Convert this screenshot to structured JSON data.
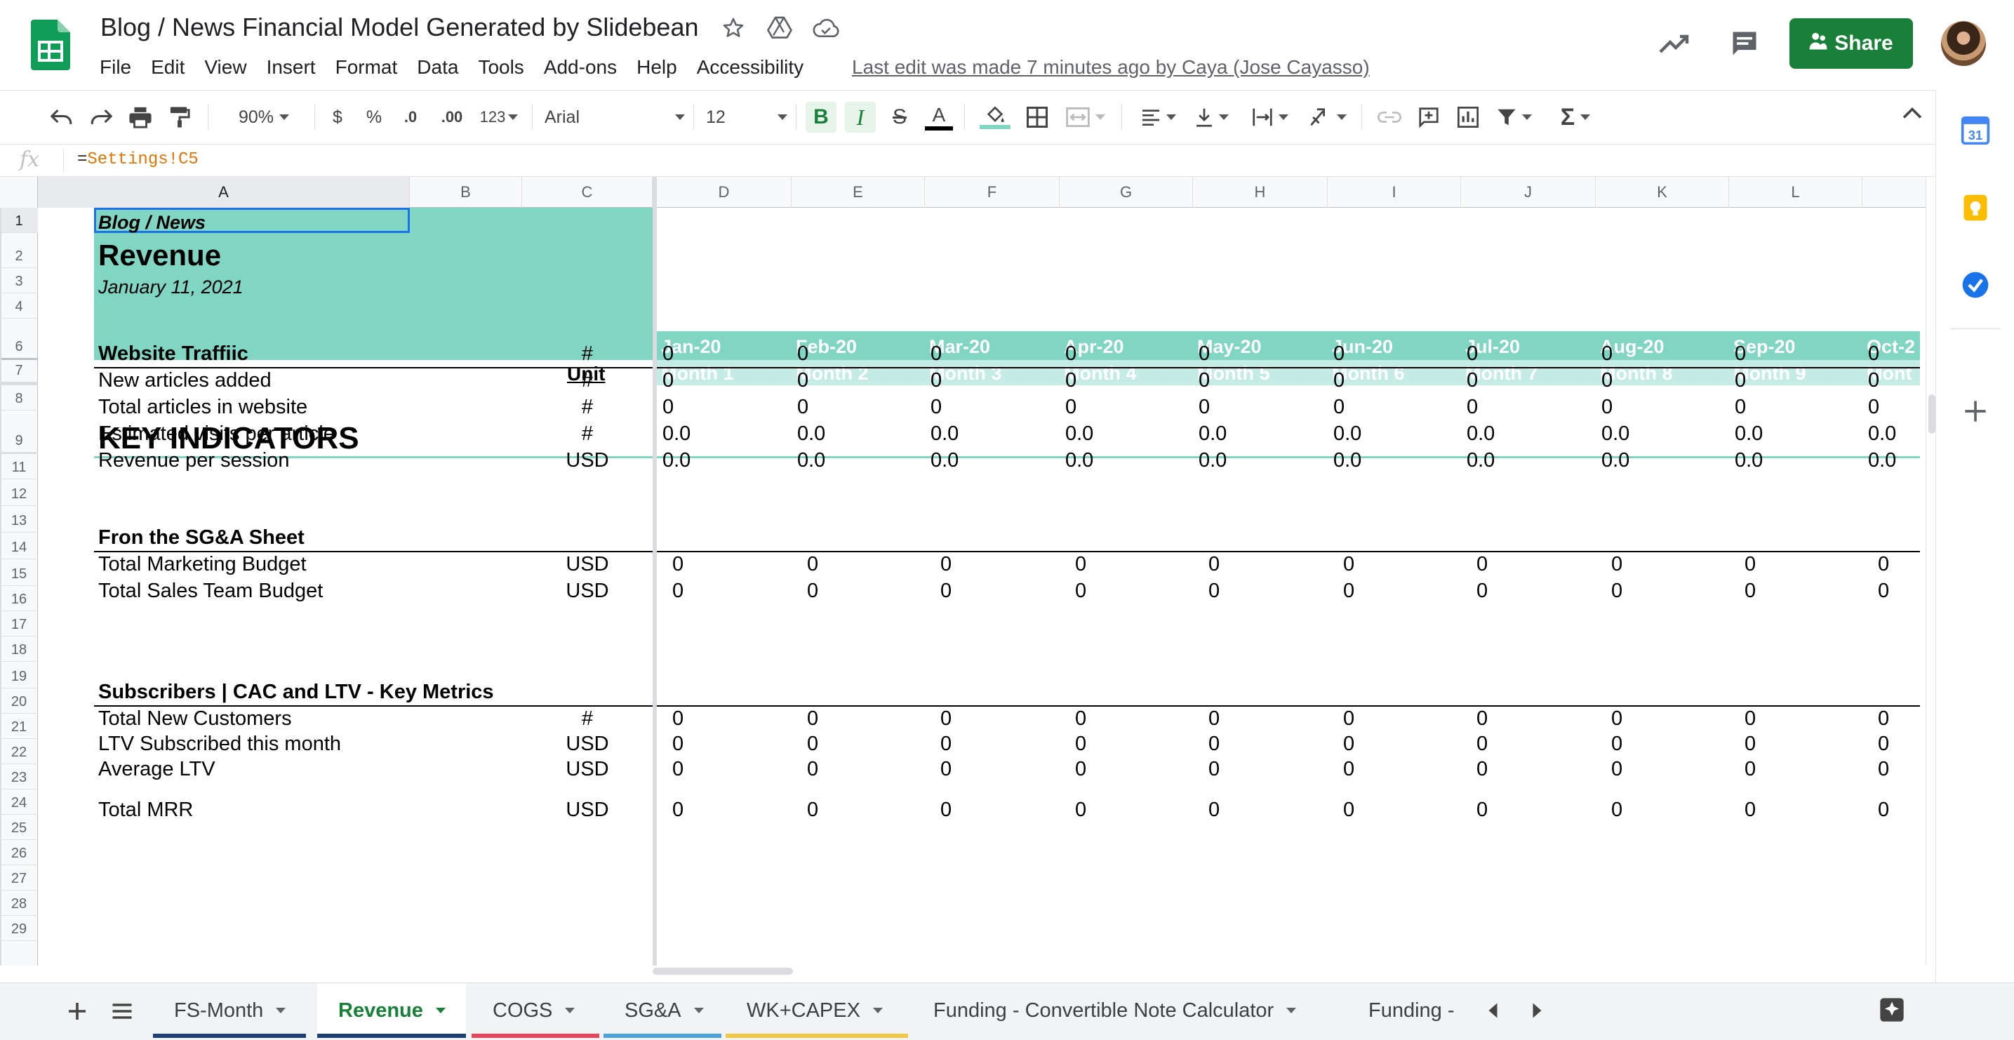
{
  "app": {
    "title": "Blog / News Financial Model Generated by Slidebean",
    "menu": [
      "File",
      "Edit",
      "View",
      "Insert",
      "Format",
      "Data",
      "Tools",
      "Add-ons",
      "Help",
      "Accessibility"
    ],
    "last_edit": "Last edit was made 7 minutes ago by Caya (Jose Cayasso)",
    "share_label": "Share"
  },
  "toolbar": {
    "zoom": "90%",
    "currency": "$",
    "percent": "%",
    "decrease_decimal": ".0",
    "increase_decimal": ".00",
    "more_formats": "123",
    "font": "Arial",
    "font_size": "12",
    "bold": "B",
    "italic": "I",
    "strike": "S",
    "text_color": "A"
  },
  "formula_bar": {
    "fx": "fx",
    "prefix": "=",
    "reference": "Settings!C5"
  },
  "columns": [
    "A",
    "B",
    "C",
    "D",
    "E",
    "F",
    "G",
    "H",
    "I",
    "J",
    "K",
    "L"
  ],
  "rows": [
    "1",
    "2",
    "3",
    "4",
    "6",
    "7",
    "8",
    "9",
    "11",
    "12",
    "13",
    "14",
    "15",
    "16",
    "17",
    "18",
    "19",
    "20",
    "21",
    "22",
    "23",
    "24",
    "25",
    "26",
    "27",
    "28",
    "29"
  ],
  "sheet": {
    "blog_news": "Blog / News",
    "revenue": "Revenue",
    "date": "January 11, 2021",
    "unit_header": "Unit",
    "key_indicators": "KEY INDICATORS",
    "months": [
      "Jan-20",
      "Feb-20",
      "Mar-20",
      "Apr-20",
      "May-20",
      "Jun-20",
      "Jul-20",
      "Aug-20",
      "Sep-20",
      "Oct-2"
    ],
    "month_nums": [
      "Month 1",
      "Month 2",
      "Month 3",
      "Month 4",
      "Month 5",
      "Month 6",
      "Month 7",
      "Month 8",
      "Month 9",
      "Mont"
    ],
    "rows": [
      {
        "label": "Website Traffiic",
        "unit": "#",
        "values": [
          "0",
          "0",
          "0",
          "0",
          "0",
          "0",
          "0",
          "0",
          "0",
          "0"
        ],
        "bold": true
      },
      {
        "label": "New articles added",
        "unit": "#",
        "values": [
          "0",
          "0",
          "0",
          "0",
          "0",
          "0",
          "0",
          "0",
          "0",
          "0"
        ]
      },
      {
        "label": "Total articles in website",
        "unit": "#",
        "values": [
          "0",
          "0",
          "0",
          "0",
          "0",
          "0",
          "0",
          "0",
          "0",
          "0"
        ]
      },
      {
        "label": "Estimated visits per article",
        "unit": "#",
        "values": [
          "0.0",
          "0.0",
          "0.0",
          "0.0",
          "0.0",
          "0.0",
          "0.0",
          "0.0",
          "0.0",
          "0.0"
        ]
      },
      {
        "label": "Revenue per session",
        "unit": "USD",
        "values": [
          "0.0",
          "0.0",
          "0.0",
          "0.0",
          "0.0",
          "0.0",
          "0.0",
          "0.0",
          "0.0",
          "0.0"
        ]
      },
      {
        "label": "Fron the SG&A Sheet",
        "bold": true
      },
      {
        "label": "Total Marketing Budget",
        "unit": "USD",
        "values": [
          "0",
          "0",
          "0",
          "0",
          "0",
          "0",
          "0",
          "0",
          "0",
          "0"
        ]
      },
      {
        "label": "Total Sales Team Budget",
        "unit": "USD",
        "values": [
          "0",
          "0",
          "0",
          "0",
          "0",
          "0",
          "0",
          "0",
          "0",
          "0"
        ]
      },
      {
        "label": "Subscribers | CAC and LTV - Key Metrics",
        "bold": true
      },
      {
        "label": "Total New Customers",
        "unit": "#",
        "values": [
          "0",
          "0",
          "0",
          "0",
          "0",
          "0",
          "0",
          "0",
          "0",
          "0"
        ]
      },
      {
        "label": "LTV Subscribed this month",
        "unit": "USD",
        "values": [
          "0",
          "0",
          "0",
          "0",
          "0",
          "0",
          "0",
          "0",
          "0",
          "0"
        ]
      },
      {
        "label": "Average LTV",
        "unit": "USD",
        "values": [
          "0",
          "0",
          "0",
          "0",
          "0",
          "0",
          "0",
          "0",
          "0",
          "0"
        ]
      },
      {
        "label": "Total MRR",
        "unit": "USD",
        "values": [
          "0",
          "0",
          "0",
          "0",
          "0",
          "0",
          "0",
          "0",
          "0",
          "0"
        ]
      }
    ]
  },
  "tabs": [
    {
      "label": "FS-Month",
      "color": "#1c3f7a",
      "active": false
    },
    {
      "label": "Revenue",
      "color": "#1c3f7a",
      "active": true
    },
    {
      "label": "COGS",
      "color": "#e8445a",
      "active": false
    },
    {
      "label": "SG&A",
      "color": "#4aa3df",
      "active": false
    },
    {
      "label": "WK+CAPEX",
      "color": "#f2c744",
      "active": false
    },
    {
      "label": "Funding - Convertible Note Calculator",
      "color": "",
      "active": false
    },
    {
      "label": "Funding -",
      "color": "",
      "active": false
    }
  ],
  "colors": {
    "accent_green": "#188038",
    "teal_header": "#80d5c3",
    "teal_light": "#c4ece4"
  }
}
